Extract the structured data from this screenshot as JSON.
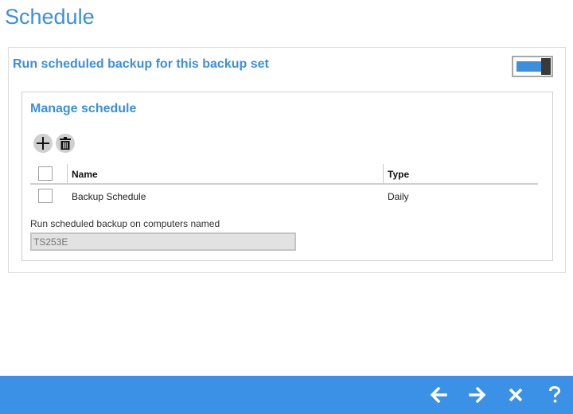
{
  "page": {
    "title": "Schedule"
  },
  "backup_toggle": {
    "label": "Run scheduled backup for this backup set",
    "enabled": true,
    "on_color": "#3c8fdc"
  },
  "manage_schedule": {
    "heading": "Manage schedule",
    "toolbar": [
      {
        "name": "add",
        "icon": "plus-icon"
      },
      {
        "name": "delete",
        "icon": "trash-icon"
      }
    ],
    "table": {
      "columns": [
        "Name",
        "Type"
      ],
      "rows": [
        {
          "name": "Backup Schedule",
          "type": "Daily",
          "checked": false
        }
      ]
    },
    "computers_label": "Run scheduled backup on computers named",
    "computers_placeholder": "TS253E"
  },
  "footer": {
    "background": "#3b91e6",
    "buttons": [
      {
        "name": "back",
        "icon": "arrow-left-icon"
      },
      {
        "name": "next",
        "icon": "arrow-right-icon"
      },
      {
        "name": "close",
        "icon": "close-x-icon"
      },
      {
        "name": "help",
        "icon": "question-icon"
      }
    ]
  }
}
